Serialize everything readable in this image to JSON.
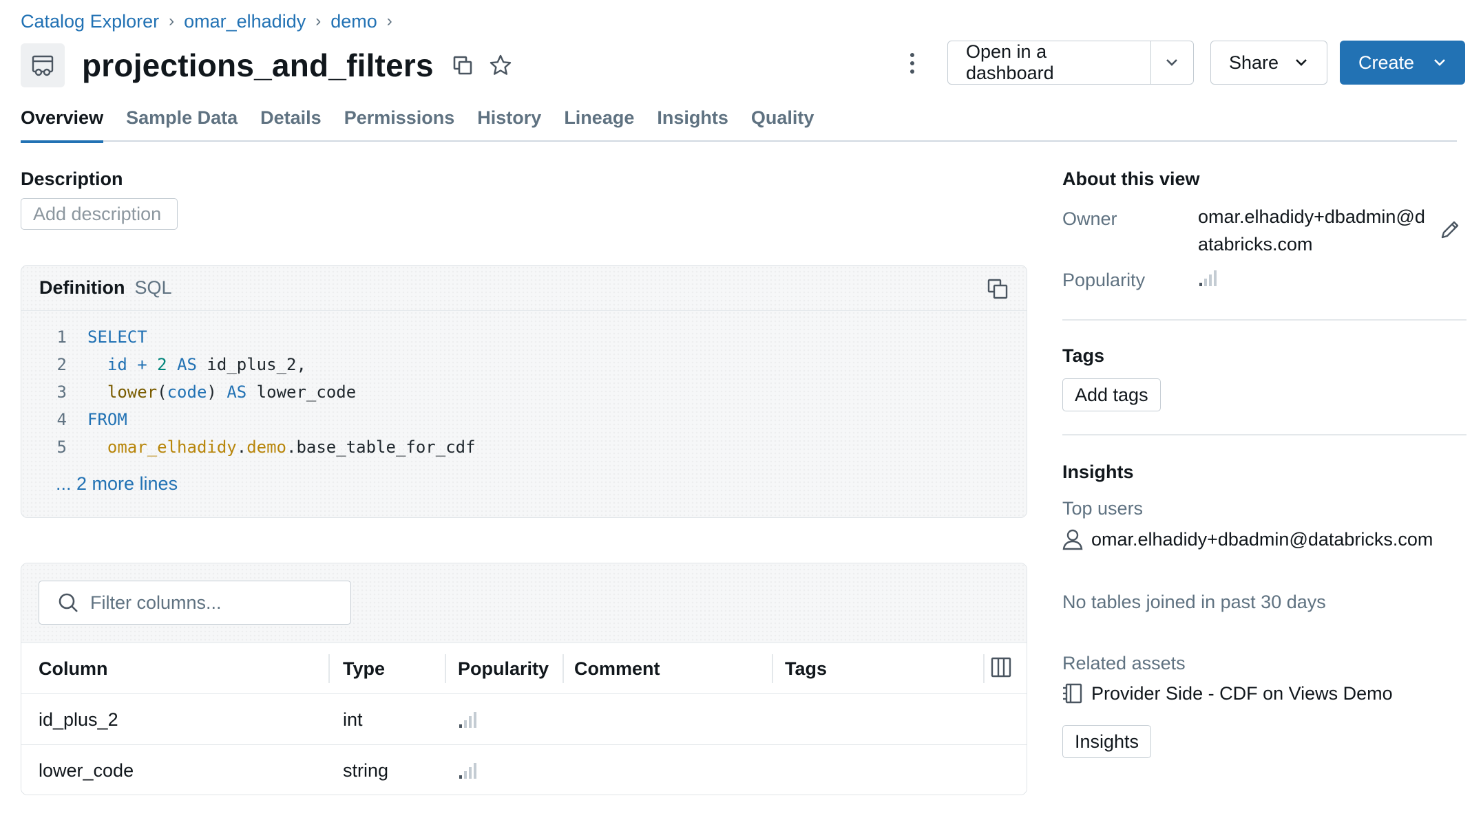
{
  "breadcrumb": [
    "Catalog Explorer",
    "omar_elhadidy",
    "demo"
  ],
  "page": {
    "title": "projections_and_filters"
  },
  "header_actions": {
    "open_dashboard": "Open in a dashboard",
    "share": "Share",
    "create": "Create"
  },
  "tabs": [
    "Overview",
    "Sample Data",
    "Details",
    "Permissions",
    "History",
    "Lineage",
    "Insights",
    "Quality"
  ],
  "description": {
    "heading": "Description",
    "add_label": "Add description"
  },
  "definition": {
    "title": "Definition",
    "language": "SQL",
    "line_numbers": [
      "1",
      "2",
      "3",
      "4",
      "5"
    ],
    "more_lines": "... 2 more lines"
  },
  "columns": {
    "filter_placeholder": "Filter columns...",
    "headers": [
      "Column",
      "Type",
      "Popularity",
      "Comment",
      "Tags"
    ],
    "rows": [
      {
        "name": "id_plus_2",
        "type": "int",
        "comment": "",
        "tags": ""
      },
      {
        "name": "lower_code",
        "type": "string",
        "comment": "",
        "tags": ""
      }
    ]
  },
  "about": {
    "heading": "About this view",
    "owner_label": "Owner",
    "owner_line1": "omar.elhadidy+dbadmin@d",
    "owner_line2": "atabricks.com",
    "popularity_label": "Popularity"
  },
  "tags": {
    "heading": "Tags",
    "add_label": "Add tags"
  },
  "insights": {
    "heading": "Insights",
    "top_users_label": "Top users",
    "top_user": "omar.elhadidy+dbadmin@databricks.com",
    "no_joins": "No tables joined in past 30 days",
    "related_label": "Related assets",
    "related_asset": "Provider Side - CDF on Views Demo",
    "insights_button": "Insights"
  },
  "colors": {
    "accent": "#2272b4",
    "muted_text": "#5f7281",
    "border": "#c4ccd3"
  }
}
